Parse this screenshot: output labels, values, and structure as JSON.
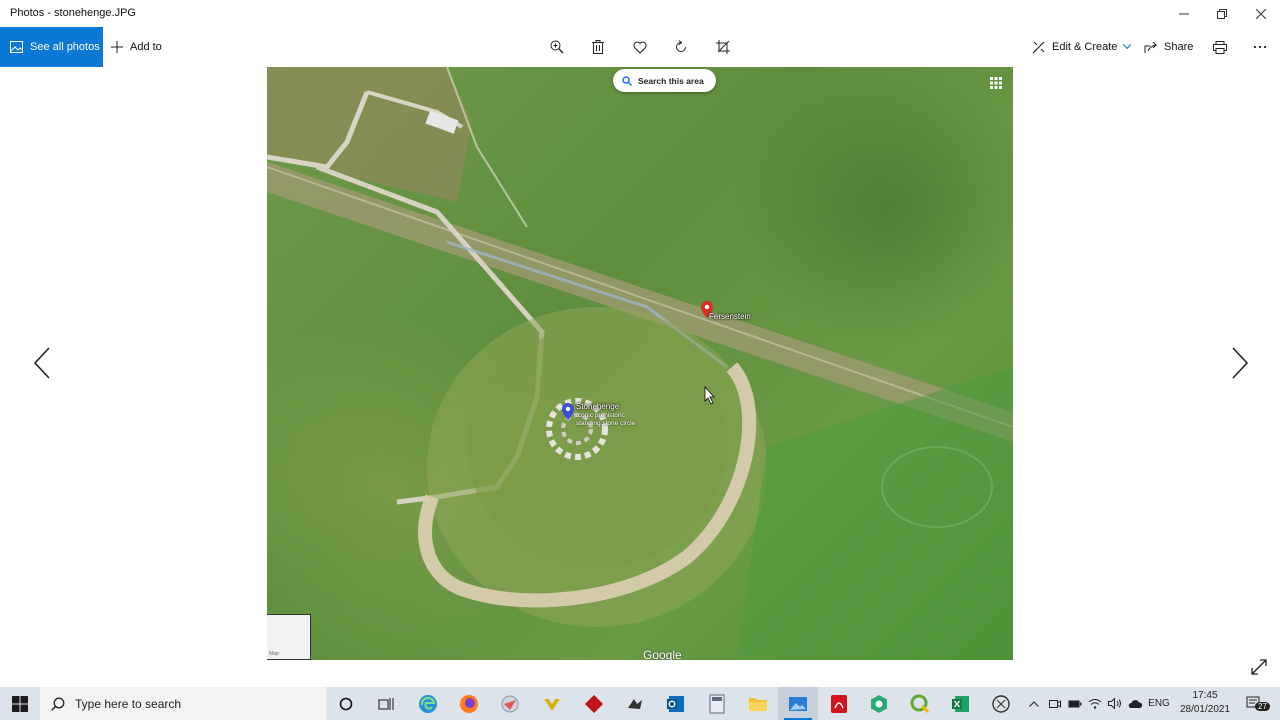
{
  "window": {
    "title": "Photos - stonehenge.JPG"
  },
  "toolbar": {
    "see_all_label": "See all photos",
    "add_to_label": "Add to",
    "edit_create_label": "Edit & Create",
    "share_label": "Share"
  },
  "map": {
    "search_label": "Search this area",
    "pin1_label": "Fersenstein",
    "pin2_title": "Stonehenge",
    "pin2_sub1": "Iconic prehistoric",
    "pin2_sub2": "standing stone circle",
    "attribution": "Google",
    "minimap_label": "Map"
  },
  "taskbar": {
    "search_placeholder": "Type here to search",
    "lang": "ENG",
    "time": "17:45",
    "date": "28/01/2021",
    "notifications_count": "27"
  },
  "colors": {
    "accent": "#0a78d4",
    "pin_red": "#d93025",
    "pin_blue": "#3c4fd6"
  }
}
